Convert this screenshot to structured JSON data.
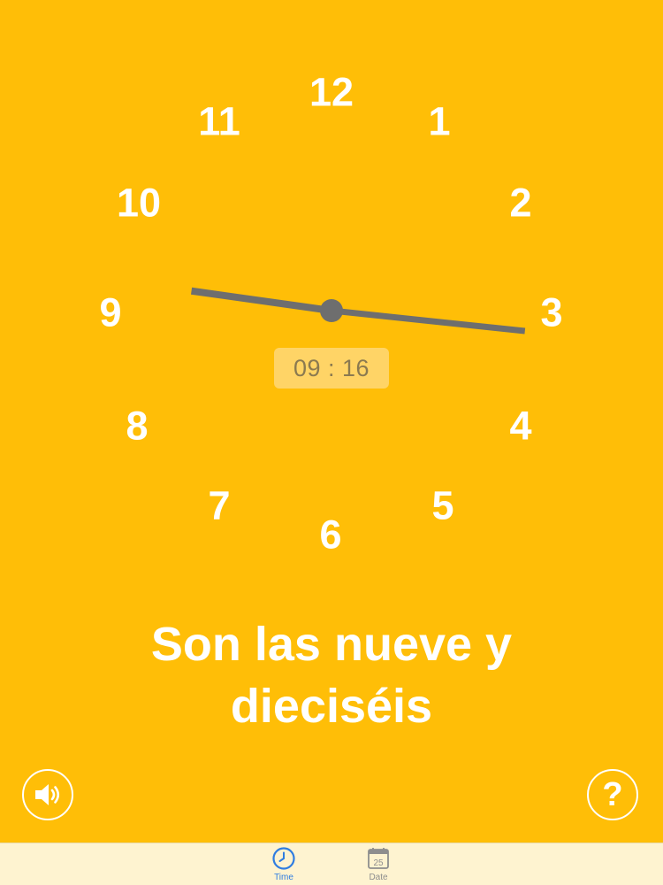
{
  "clock": {
    "numerals": [
      "12",
      "1",
      "2",
      "3",
      "4",
      "5",
      "6",
      "7",
      "8",
      "9",
      "10",
      "11"
    ],
    "hour": 9,
    "minute": 16
  },
  "digital": {
    "hours": "09",
    "separator": ":",
    "minutes": "16"
  },
  "phrase": "Son las nueve y dieciséis",
  "buttons": {
    "help_label": "?"
  },
  "tabbar": {
    "tabs": [
      {
        "label": "Time",
        "icon": "clock-icon",
        "selected": true
      },
      {
        "label": "Date",
        "icon": "calendar-icon",
        "selected": false,
        "icon_text": "25"
      }
    ]
  },
  "colors": {
    "background": "#FFBE07",
    "hand": "#6E6E6E",
    "digital_bg": "#FFD466",
    "digital_text": "#8B7A50",
    "tabbar_bg": "#FEF3D0",
    "tab_selected": "#2F7DE1",
    "tab_unselected": "#8E8E8E"
  }
}
